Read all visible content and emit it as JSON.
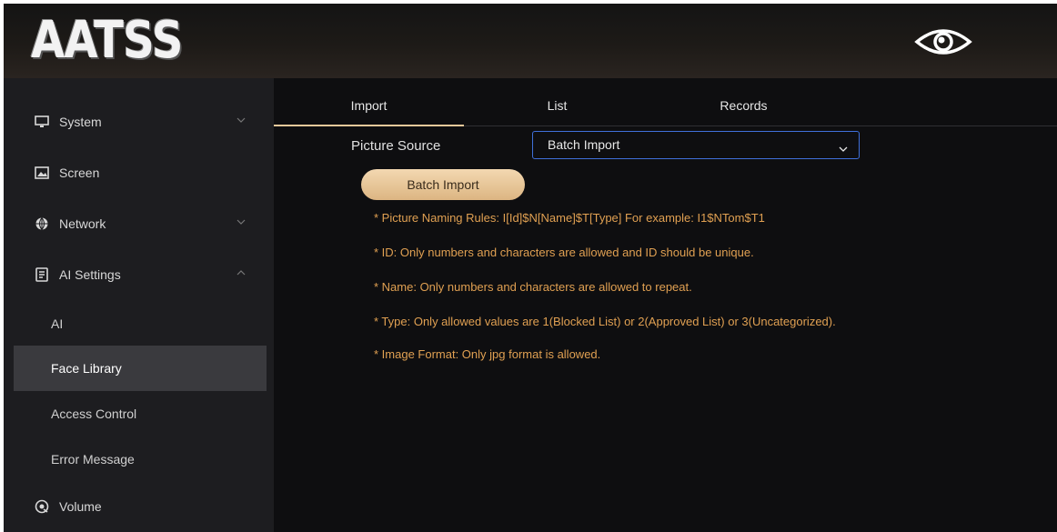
{
  "header": {
    "logo_text": "AATSS",
    "eye_icon": "eye-icon"
  },
  "sidebar": {
    "items": [
      {
        "label": "System",
        "icon": "monitor-icon",
        "chevron": "down"
      },
      {
        "label": "Screen",
        "icon": "image-icon"
      },
      {
        "label": "Network",
        "icon": "globe-icon",
        "chevron": "down"
      },
      {
        "label": "AI Settings",
        "icon": "document-icon",
        "chevron": "up"
      }
    ],
    "sub_items": [
      {
        "label": "AI"
      },
      {
        "label": "Face Library",
        "active": true
      },
      {
        "label": "Access Control"
      },
      {
        "label": "Error Message"
      }
    ],
    "volume": {
      "label": "Volume",
      "icon": "volume-icon"
    }
  },
  "tabs": [
    {
      "label": "Import",
      "active": true
    },
    {
      "label": "List"
    },
    {
      "label": "Records"
    }
  ],
  "form": {
    "picture_source_label": "Picture Source",
    "picture_source_value": "Batch Import",
    "batch_import_button": "Batch Import"
  },
  "rules": [
    "* Picture Naming Rules: I[Id]$N[Name]$T[Type] For example: I1$NTom$T1",
    "* ID: Only numbers and characters are allowed and ID should be unique.",
    "* Name: Only numbers and characters are allowed to repeat.",
    "* Type: Only allowed values are 1(Blocked List) or 2(Approved List) or 3(Uncategorized).",
    "* Image Format: Only jpg format is allowed."
  ],
  "colors": {
    "accent": "#e9c89a",
    "rule_text": "#e0a052",
    "select_border": "#3f6fd9",
    "active_sub_bg": "#3a3a3e"
  }
}
